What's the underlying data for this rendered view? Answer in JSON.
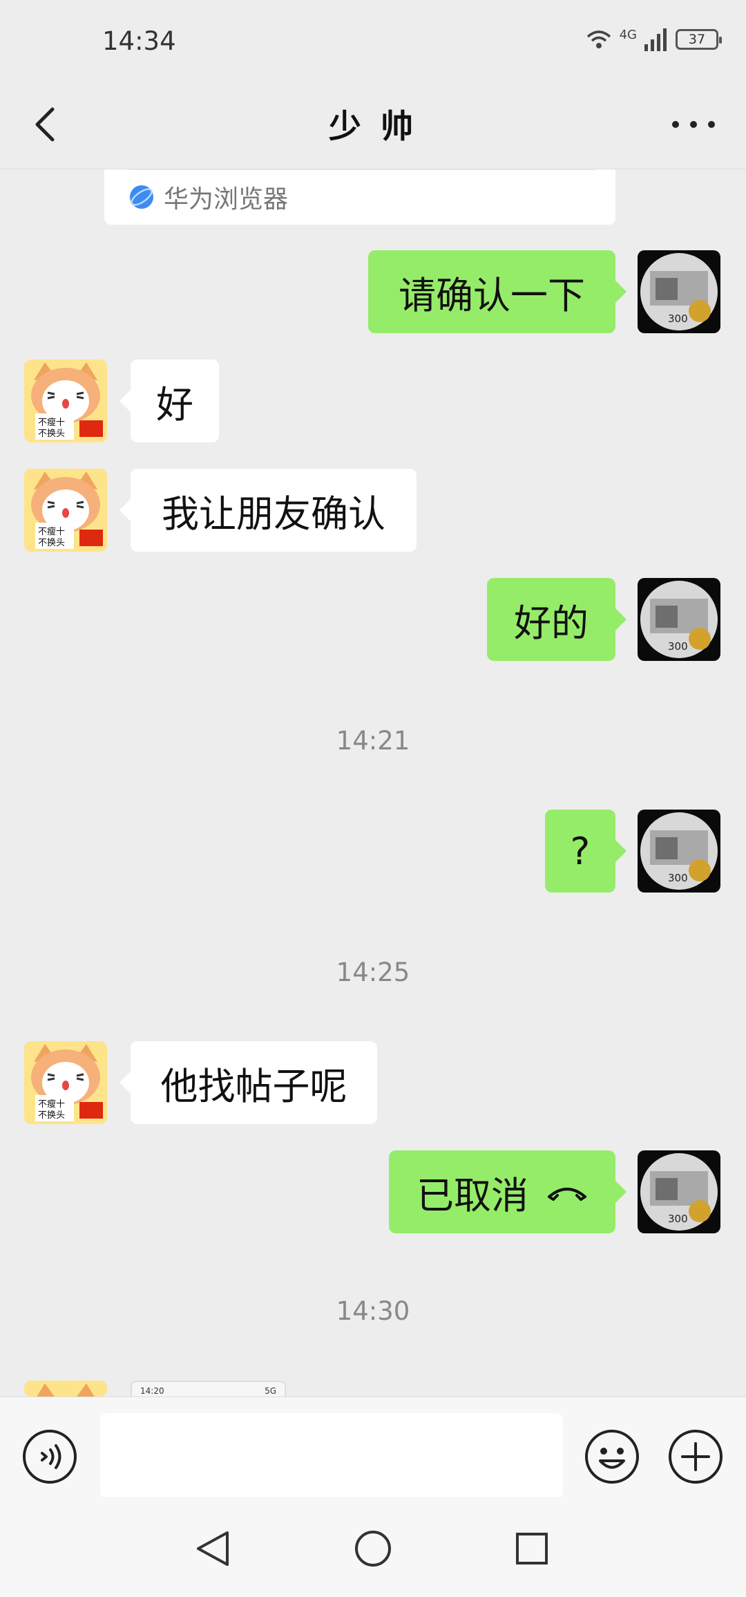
{
  "status_bar": {
    "time": "14:34",
    "network": "4G",
    "battery": "37"
  },
  "header": {
    "title": "少 帅"
  },
  "link_card": {
    "source": "华为浏览器"
  },
  "messages": [
    {
      "side": "right",
      "text": "请确认一下"
    },
    {
      "side": "left",
      "text": "好"
    },
    {
      "side": "left",
      "text": "我让朋友确认"
    },
    {
      "side": "right",
      "text": "好的"
    },
    {
      "side": "right",
      "text": "?"
    },
    {
      "side": "left",
      "text": "他找帖子呢"
    },
    {
      "side": "right",
      "text": "已取消",
      "icon": "call-cancelled-icon"
    }
  ],
  "timestamps": [
    "14:21",
    "14:25",
    "14:30"
  ],
  "partial_image": {
    "time": "14:20",
    "network": "5G"
  },
  "avatars": {
    "left_text_1": "不瘦十",
    "left_text_2": "不换头",
    "right_label": "300"
  },
  "input": {
    "value": "",
    "placeholder": ""
  },
  "colors": {
    "background": "#ededed",
    "sent_bubble": "#95ec69",
    "received_bubble": "#ffffff",
    "timestamp": "#888888"
  }
}
